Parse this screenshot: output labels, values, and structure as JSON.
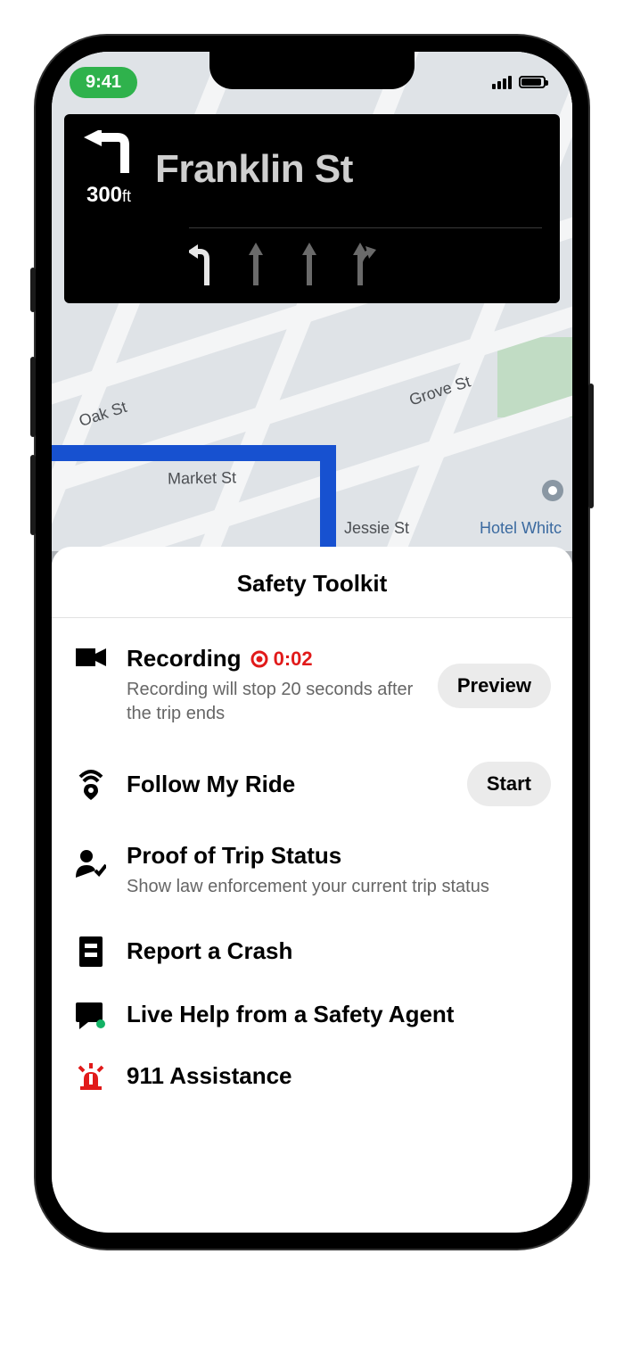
{
  "status": {
    "time": "9:41"
  },
  "navigation": {
    "street": "Franklin St",
    "distance_value": "300",
    "distance_unit": "ft"
  },
  "map": {
    "labels": {
      "oak": "Oak St",
      "market": "Market St",
      "jessie": "Jessie St",
      "grove": "Grove St",
      "hotel": "Hotel Whitc"
    }
  },
  "sheet": {
    "title": "Safety Toolkit",
    "items": [
      {
        "icon": "camera",
        "title": "Recording",
        "rec_time": "0:02",
        "subtitle": "Recording will stop 20 seconds after the trip ends",
        "action": "Preview"
      },
      {
        "icon": "beacon",
        "title": "Follow My Ride",
        "action": "Start"
      },
      {
        "icon": "person-check",
        "title": "Proof of Trip Status",
        "subtitle": "Show law enforcement your current trip status"
      },
      {
        "icon": "report",
        "title": "Report a Crash"
      },
      {
        "icon": "chat-agent",
        "title": "Live Help from a Safety Agent"
      },
      {
        "icon": "siren",
        "title": "911 Assistance"
      }
    ]
  }
}
